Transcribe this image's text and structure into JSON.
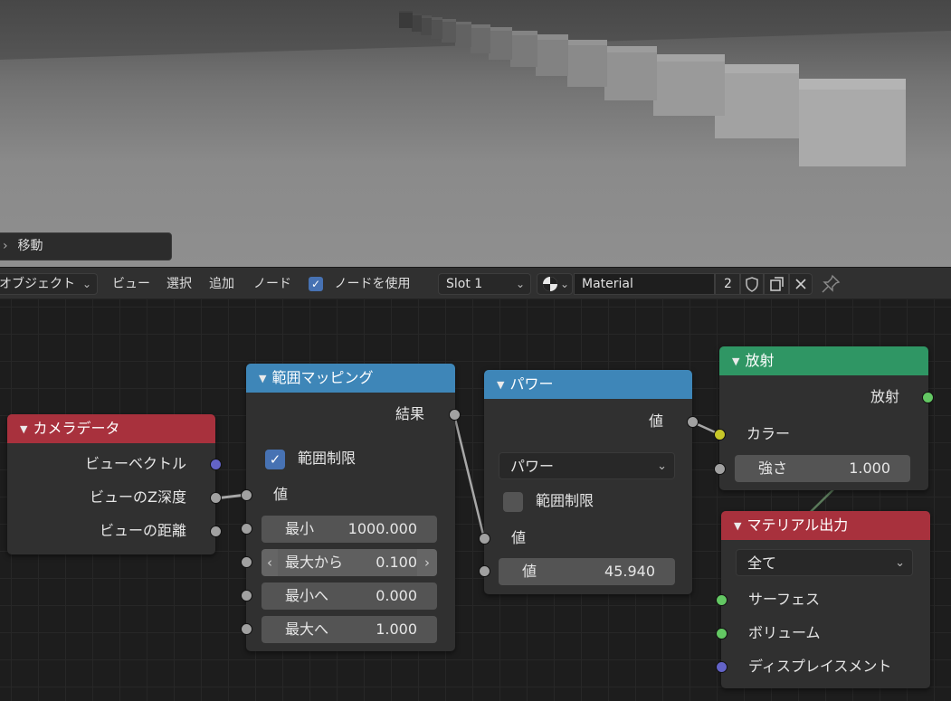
{
  "viewport": {
    "last_operator": "移動"
  },
  "header": {
    "mode": "オブジェクト",
    "menu": [
      "ビュー",
      "選択",
      "追加",
      "ノード"
    ],
    "use_nodes_label": "ノードを使用",
    "use_nodes_checked": true,
    "slot": "Slot 1",
    "material_name": "Material",
    "user_count": "2"
  },
  "nodes": {
    "camera_data": {
      "title": "カメラデータ",
      "outputs": [
        "ビューベクトル",
        "ビューのZ深度",
        "ビューの距離"
      ]
    },
    "map_range": {
      "title": "範囲マッピング",
      "output": "結果",
      "clamp_label": "範囲制限",
      "clamp_checked": true,
      "value_label": "値",
      "from_min_label": "最小",
      "from_min_value": "1000.000",
      "from_max_label": "最大から",
      "from_max_value": "0.100",
      "to_min_label": "最小へ",
      "to_min_value": "0.000",
      "to_max_label": "最大へ",
      "to_max_value": "1.000"
    },
    "power": {
      "title": "パワー",
      "output": "値",
      "operation": "パワー",
      "clamp_label": "範囲制限",
      "clamp_checked": false,
      "input1_label": "値",
      "input2_label": "値",
      "input2_value": "45.940"
    },
    "emission": {
      "title": "放射",
      "output": "放射",
      "color_label": "カラー",
      "strength_label": "強さ",
      "strength_value": "1.000"
    },
    "material_output": {
      "title": "マテリアル出力",
      "target": "全て",
      "inputs": [
        "サーフェス",
        "ボリューム",
        "ディスプレイスメント"
      ]
    }
  },
  "colors": {
    "header_red": "#a8313d",
    "header_blue": "#3e86b8",
    "header_green": "#2f9664",
    "socket_gray": "#a1a1a1",
    "socket_blue": "#6363c7",
    "socket_yellow": "#c7c729",
    "socket_green": "#63c763",
    "checkbox_blue": "#4772b3"
  },
  "icons": [
    "checkbox-icon",
    "chevron-down-icon",
    "material-sphere-icon",
    "fake-user-shield-icon",
    "duplicate-icon",
    "close-icon",
    "pin-icon",
    "collapse-triangle-icon"
  ]
}
